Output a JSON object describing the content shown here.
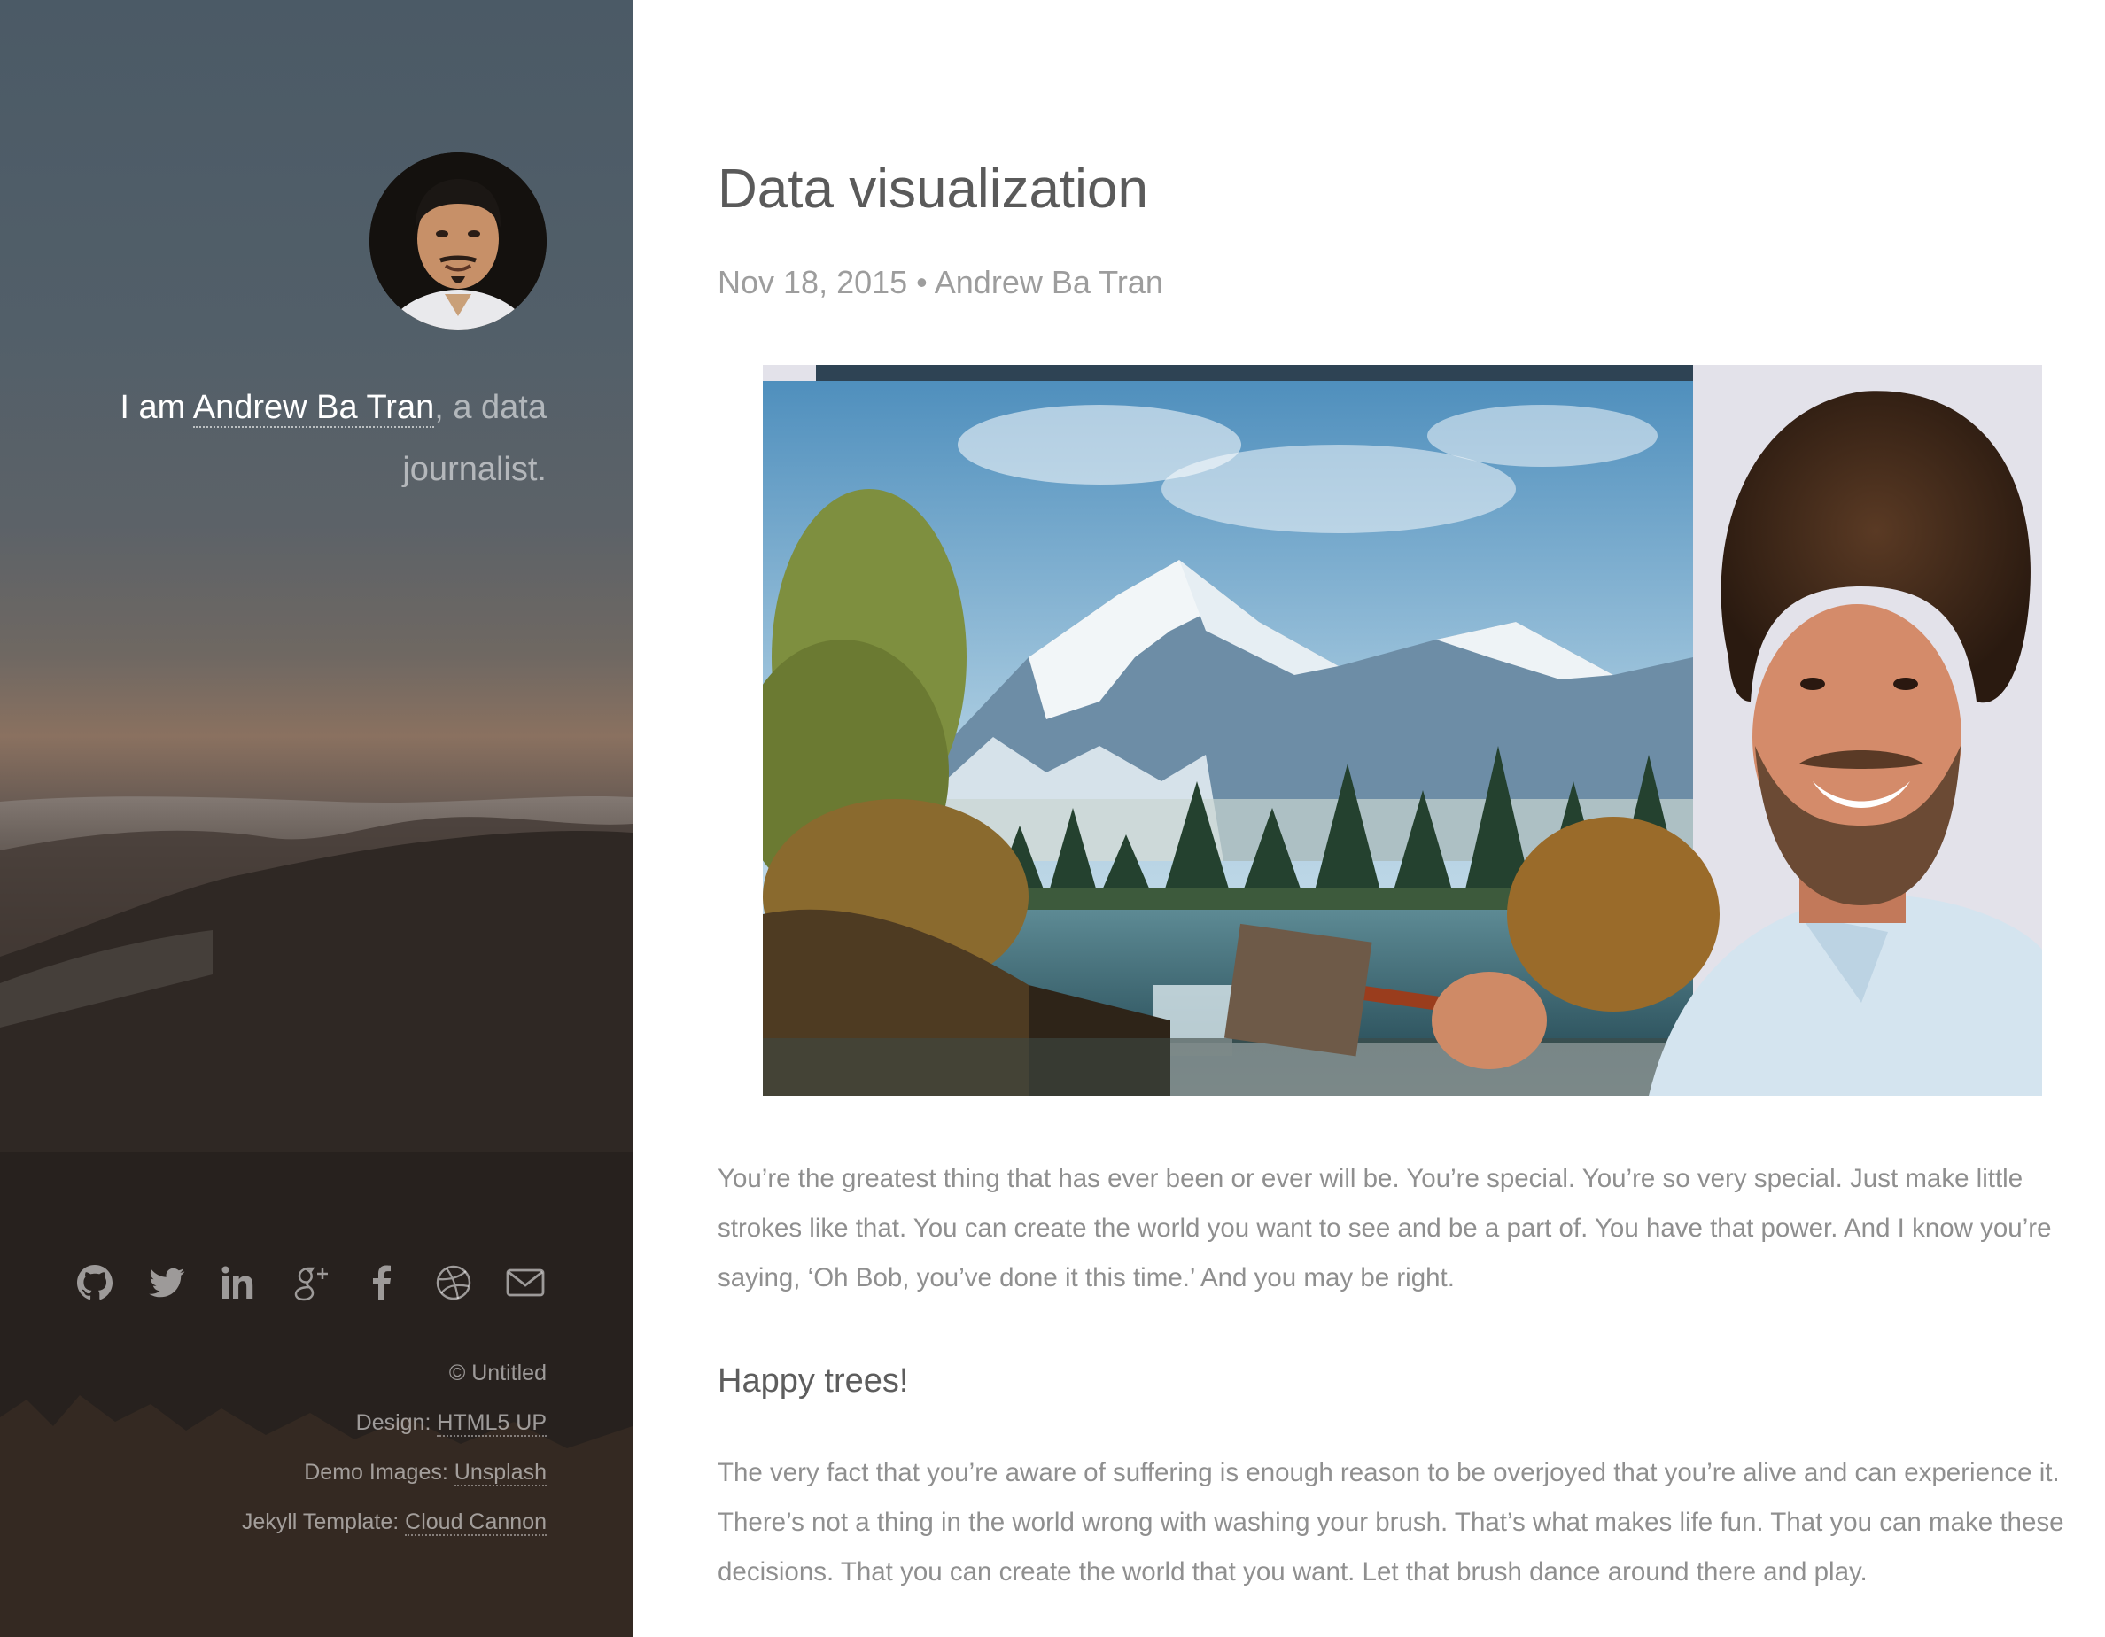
{
  "sidebar": {
    "intro_lead": "I am ",
    "name_link": "Andrew Ba Tran",
    "intro_tail": ", a data journalist.",
    "social": [
      {
        "icon": "github-icon"
      },
      {
        "icon": "twitter-icon"
      },
      {
        "icon": "linkedin-icon"
      },
      {
        "icon": "google-plus-icon"
      },
      {
        "icon": "facebook-icon"
      },
      {
        "icon": "dribbble-icon"
      },
      {
        "icon": "email-icon"
      }
    ],
    "copyright": "© Untitled",
    "design_label": "Design: ",
    "design_link": "HTML5 UP",
    "demo_label": "Demo Images: ",
    "demo_link": "Unsplash",
    "jekyll_label": "Jekyll Template: ",
    "jekyll_link": "Cloud Cannon"
  },
  "post": {
    "title": "Data visualization",
    "meta": "Nov 18, 2015 • Andrew Ba Tran",
    "paragraph_1": "You’re the greatest thing that has ever been or ever will be. You’re special. You’re so very special. Just make little strokes like that. You can create the world you want to see and be a part of. You have that power. And I know you’re saying, ‘Oh Bob, you’ve done it this time.’ And you may be right.",
    "subheading": "Happy trees!",
    "paragraph_2": "The very fact that you’re aware of suffering is enough reason to be overjoyed that you’re alive and can experience it. There’s not a thing in the world wrong with washing your brush. That’s what makes life fun. That you can make these decisions. That you can create the world that you want. Let that brush dance around there and play."
  },
  "colors": {
    "main_text": "#5a5a5a",
    "muted_text": "#9d9d9d",
    "body_text": "#8f8f8f"
  }
}
